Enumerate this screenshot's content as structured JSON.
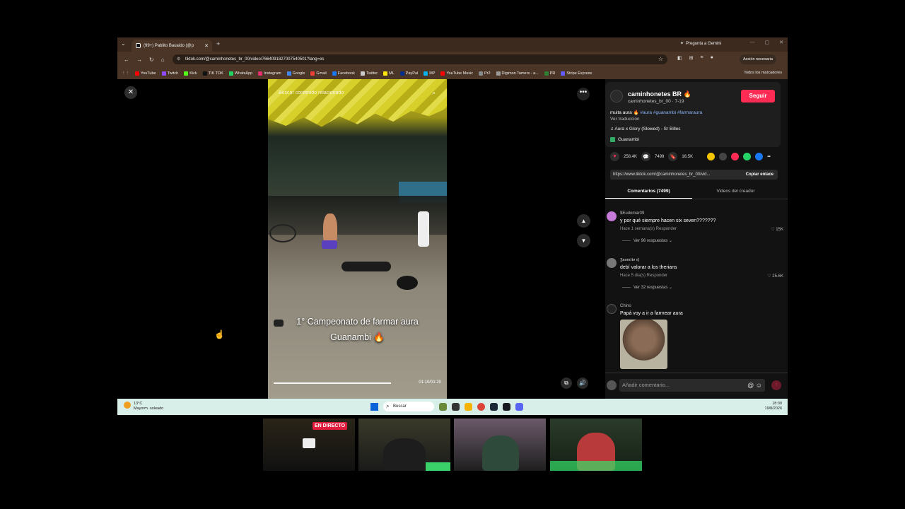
{
  "browser": {
    "tab_title": "(99+) Pablito Bauaido (@p",
    "gemini_label": "Pregunta a Gemini",
    "url": "tiktok.com/@caminhonetes_br_00/video/7664091827007540501?lang=es",
    "action_button": "Acción necesaria",
    "bookmarks": [
      {
        "label": "YouTube",
        "color": "#ff0000"
      },
      {
        "label": "Twitch",
        "color": "#9146ff"
      },
      {
        "label": "Kick",
        "color": "#53fc18"
      },
      {
        "label": "TIK TOK",
        "color": "#111111"
      },
      {
        "label": "WhatsApp",
        "color": "#25d366"
      },
      {
        "label": "Instagram",
        "color": "#e1306c"
      },
      {
        "label": "Google",
        "color": "#4285f4"
      },
      {
        "label": "Gmail",
        "color": "#ea4335"
      },
      {
        "label": "Facebook",
        "color": "#1877f2"
      },
      {
        "label": "Twitter",
        "color": "#cccccc"
      },
      {
        "label": "ML",
        "color": "#ffe600"
      },
      {
        "label": "PayPal",
        "color": "#003087"
      },
      {
        "label": "MP",
        "color": "#00b1ea"
      },
      {
        "label": "YouTube Music",
        "color": "#ff0000"
      },
      {
        "label": "Pr2",
        "color": "#888888"
      },
      {
        "label": "Digimon Tamers - a...",
        "color": "#999999"
      },
      {
        "label": "PR",
        "color": "#2e7d32"
      },
      {
        "label": "Stripe Express",
        "color": "#635bff"
      }
    ],
    "all_bookmarks": "Todos los marcadores"
  },
  "video": {
    "search_placeholder": "Buscar contenido relacionado",
    "caption_line1": "1° Campeonato de farmar aura",
    "caption_line2": "Guanambi 🔥",
    "time": "01:10/01:20",
    "progress": 0.85
  },
  "author": {
    "name": "caminhonetes BR 🔥",
    "handle": "caminhonetes_br_00 · 7-19",
    "follow": "Seguir",
    "desc_text": "muita aura 🔥 ",
    "desc_tags": "#aura #guanambi #farmaraura",
    "translate": "Ver traducción",
    "music": "♫  Aura x Glory (Slowed) - Sr Billes",
    "location": "Guanambi"
  },
  "stats": {
    "likes": "258.4K",
    "comments": "7499",
    "saves": "16.5K"
  },
  "link": {
    "url": "https://www.tiktok.com/@caminhonetes_br_00/vid...",
    "copy": "Copiar enlace"
  },
  "tabs": {
    "comments": "Comentarios (7499)",
    "creator_videos": "Videos del creador"
  },
  "comments": [
    {
      "user": "$Eudomar09",
      "text": "y por qué siempre hacen six seven???????",
      "meta": "Hace 1 semana(s)    Responder",
      "likes": "♡ 15K",
      "replies": "Ver 96 respuestas ⌄"
    },
    {
      "user": "𝕵𝖚𝖆𝖓𝖈𝖎𝖙𝖔 𝖊𝖏",
      "text": "debí valorar a los therians",
      "meta": "Hace 5 día(s)    Responder",
      "likes": "♡ 25.6K",
      "replies": "Ver 32 respuestas ⌄"
    },
    {
      "user": "Chino",
      "text": "Papá voy a ir a farmear aura"
    }
  ],
  "comment_input": {
    "placeholder": "Añadir comentario..."
  },
  "taskbar": {
    "temp": "13°C",
    "weather": "Mayorm. soleado",
    "search": "Buscar",
    "time": "18:00",
    "date": "19/8/2026"
  },
  "stream": {
    "live": "EN DIRECTO"
  }
}
